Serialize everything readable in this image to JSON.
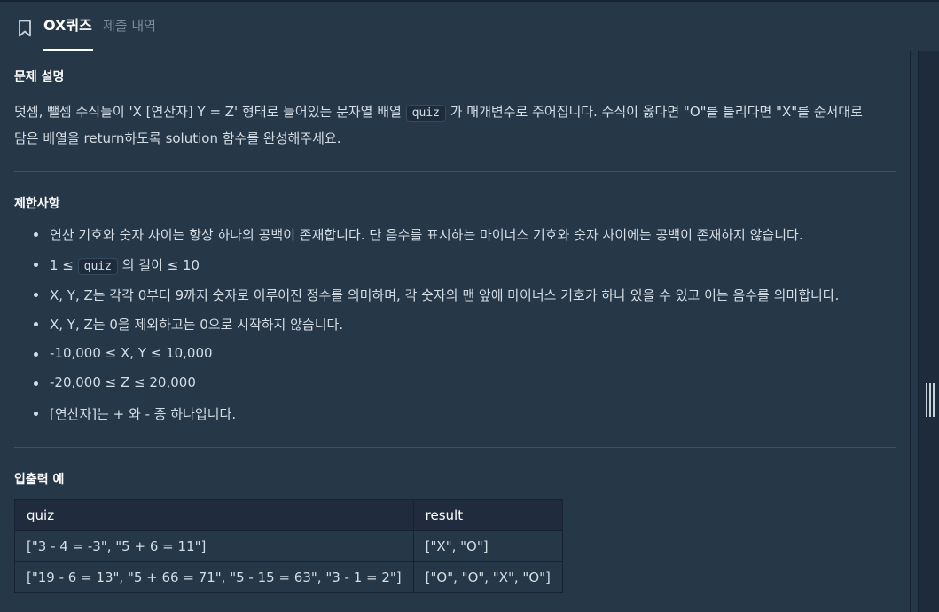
{
  "tabs": {
    "active": "OX퀴즈",
    "inactive": "제출 내역"
  },
  "description": {
    "title": "문제 설명",
    "line1_pre": "덧셈, 뺄셈 수식들이 'X [연산자] Y = Z' 형태로 들어있는 문자열 배열 ",
    "line1_code": "quiz",
    "line1_post": " 가 매개변수로 주어집니다. 수식이 옳다면 \"O\"를 틀리다면 \"X\"를 순서대로",
    "line2": "담은 배열을 return하도록 solution 함수를 완성해주세요."
  },
  "constraints": {
    "title": "제한사항",
    "items": [
      "연산 기호와 숫자 사이는 항상 하나의 공백이 존재합니다. 단 음수를 표시하는 마이너스 기호와 숫자 사이에는 공백이 존재하지 않습니다.",
      "X, Y, Z는 각각 0부터 9까지 숫자로 이루어진 정수를 의미하며, 각 숫자의 맨 앞에 마이너스 기호가 하나 있을 수 있고 이는 음수를 의미합니다.",
      "X, Y, Z는 0을 제외하고는 0으로 시작하지 않습니다.",
      "-10,000 ≤ X, Y ≤ 10,000",
      "-20,000 ≤ Z ≤ 20,000",
      "[연산자]는 + 와 - 중 하나입니다."
    ],
    "length_pre": "1 ≤ ",
    "length_code": "quiz",
    "length_post": " 의 길이 ≤ 10"
  },
  "examples": {
    "title": "입출력 예",
    "headers": [
      "quiz",
      "result"
    ],
    "rows": [
      [
        "[\"3 - 4 = -3\", \"5 + 6 = 11\"]",
        "[\"X\", \"O\"]"
      ],
      [
        "[\"19 - 6 = 13\", \"5 + 66 = 71\", \"5 - 15 = 63\", \"3 - 1 = 2\"]",
        "[\"O\", \"O\", \"X\", \"O\"]"
      ]
    ]
  }
}
